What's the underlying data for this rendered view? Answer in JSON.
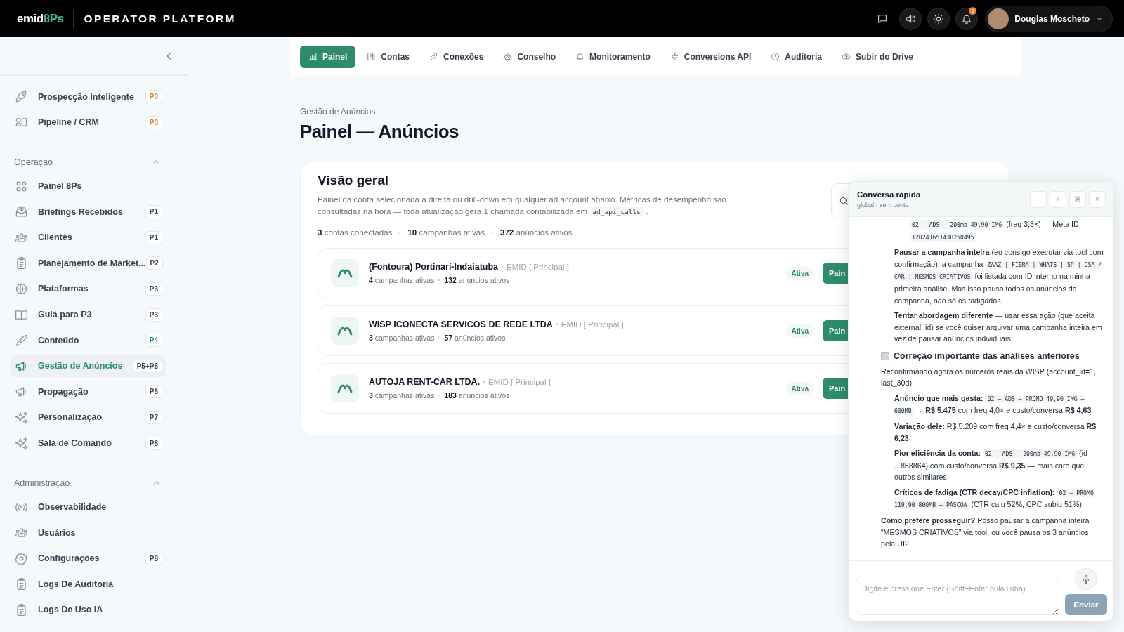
{
  "topbar": {
    "logo": {
      "text": "emid",
      "accent": "8Ps"
    },
    "title": "OPERATOR PLATFORM",
    "notification_count": "2",
    "user": {
      "name": "Douglas Moscheto"
    }
  },
  "sidebar": {
    "sections": [
      {
        "items": [
          {
            "label": "Prospecção Inteligente",
            "badge": "P0",
            "color": "#d9822b",
            "selected": false
          },
          {
            "label": "Pipeline / CRM",
            "badge": "P0",
            "color": "#d9822b",
            "selected": false
          }
        ]
      },
      {
        "title": "Operação",
        "expanded": true,
        "items": [
          {
            "label": "Painel 8Ps",
            "selected": false
          },
          {
            "label": "Briefings Recebidos",
            "badge": "P1",
            "color": "#374151",
            "selected": false
          },
          {
            "label": "Clientes",
            "badge": "P1",
            "color": "#374151",
            "selected": false
          },
          {
            "label": "Planejamento de Market...",
            "badge": "P2",
            "color": "#374151",
            "selected": false
          },
          {
            "label": "Plataformas",
            "badge": "P3",
            "color": "#374151",
            "selected": false
          },
          {
            "label": "Guia para P3",
            "badge": "P3",
            "color": "#374151",
            "selected": false
          },
          {
            "label": "Conteúdo",
            "badge": "P4",
            "color": "#2e8b6e",
            "selected": false
          },
          {
            "label": "Gestão de Anúncios",
            "badge": "P5+P8",
            "color": "#374151",
            "selected": true
          },
          {
            "label": "Propagação",
            "badge": "P6",
            "color": "#374151",
            "selected": false
          },
          {
            "label": "Personalização",
            "badge": "P7",
            "color": "#374151",
            "selected": false
          },
          {
            "label": "Sala de Comando",
            "badge": "P8",
            "color": "#374151",
            "selected": false
          }
        ]
      },
      {
        "title": "Administração",
        "expanded": true,
        "items": [
          {
            "label": "Observabilidade",
            "selected": false
          },
          {
            "label": "Usuários",
            "selected": false
          },
          {
            "label": "Configurações",
            "badge": "P8",
            "color": "#374151",
            "selected": false
          },
          {
            "label": "Logs De Auditoria",
            "selected": false
          },
          {
            "label": "Logs De Uso IA",
            "selected": false
          }
        ]
      }
    ]
  },
  "tabs": [
    {
      "label": "Painel",
      "selected": true
    },
    {
      "label": "Contas",
      "selected": false
    },
    {
      "label": "Conexões",
      "selected": false
    },
    {
      "label": "Conselho",
      "selected": false
    },
    {
      "label": "Monitoramento",
      "selected": false
    },
    {
      "label": "Conversions API",
      "selected": false
    },
    {
      "label": "Auditoria",
      "selected": false
    },
    {
      "label": "Subir do Drive",
      "selected": false
    }
  ],
  "page": {
    "breadcrumb": "Gestão de Anúncios",
    "title": "Painel — Anúncios"
  },
  "overview": {
    "title": "Visão geral",
    "description": [
      {
        "kind": "text",
        "text": "Painel da conta selecionada à direita ou drill-down em qualquer ad account abaixo. Métricas de desempenho são consultadas na hora — toda atualização gera 1 chamada contabilizada em "
      },
      {
        "kind": "code",
        "text": "ad_api_calls"
      },
      {
        "kind": "text",
        "text": " ."
      }
    ],
    "stats": [
      "**3** contas conectadas",
      "**10** campanhas ativas",
      "**372** anúncios ativos"
    ],
    "accounts": [
      {
        "name": "(Fontoura) Portinari-Indaiatuba",
        "tag": "EMID [ Principal ]",
        "campaigns": "4",
        "campaigns_label": "campanhas ativas",
        "ads": "132",
        "ads_label": "anúncios ativos",
        "status": "Ativa",
        "button": "Pain"
      },
      {
        "name": "WISP ICONECTA SERVICOS DE REDE LTDA",
        "tag": "EMID [ Principal ]",
        "campaigns": "3",
        "campaigns_label": "campanhas ativas",
        "ads": "57",
        "ads_label": "anúncios ativos",
        "status": "Ativa",
        "button": "Pain"
      },
      {
        "name": "AUTOJA RENT-CAR LTDA.",
        "tag": "EMID [ Principal ]",
        "campaigns": "3",
        "campaigns_label": "campanhas ativas",
        "ads": "183",
        "ads_label": "anúncios ativos",
        "status": "Ativa",
        "button": "Pain"
      }
    ]
  },
  "chat": {
    "title": "Conversa rápida",
    "subtitle": "global · sem conta",
    "header_buttons": [
      "·",
      "+",
      "⌘",
      "×"
    ],
    "blocks": [
      {
        "kind": "subitem",
        "segments": [
          {
            "kind": "code",
            "text": "02 – ADS – 200mb 49,90 IMG"
          },
          {
            "kind": "text",
            "text": " (freq 3,3×) — Meta ID "
          },
          {
            "kind": "code",
            "text": "120241651438250495"
          }
        ]
      },
      {
        "kind": "item",
        "segments": [
          {
            "kind": "text",
            "text": "**Pausar a campanha inteira** (eu consigo executar via tool com confirmação): a campanha "
          },
          {
            "kind": "code",
            "text": "ZAAZ | FIBRA | WHATS | SP | OSA / CAR | MESMOS CRIATIVOS"
          },
          {
            "kind": "text",
            "text": " foi listada com ID interno na minha primeira análise. Mas isso pausa todos os anúncios da campanha, não só os fadigados."
          }
        ]
      },
      {
        "kind": "item",
        "segments": [
          {
            "kind": "text",
            "text": "**Tentar abordagem diferente** — usar essa ação (que aceita external_id) se você quiser arquivar uma campanha inteira em vez de pausar anúncios individuais."
          }
        ]
      },
      {
        "kind": "heading",
        "segments": [
          {
            "kind": "text",
            "text": "Correção importante das análises anteriores"
          }
        ]
      },
      {
        "kind": "para",
        "segments": [
          {
            "kind": "text",
            "text": "Reconfirmando agora os números reais da WISP (account_id=1, last_30d):"
          }
        ]
      },
      {
        "kind": "item",
        "segments": [
          {
            "kind": "text",
            "text": "**Anúncio que mais gasta:** "
          },
          {
            "kind": "code",
            "text": "02 – ADS – PROMO 49,90 IMG – 600MB"
          },
          {
            "kind": "text",
            "text": " → **R$ 5.475** com freq 4,0× e custo/conversa **R$ 4,63**"
          }
        ]
      },
      {
        "kind": "item",
        "segments": [
          {
            "kind": "text",
            "text": "**Variação dele:** R$ 5.209 com freq 4,4× e custo/conversa **R$ 6,23**"
          }
        ]
      },
      {
        "kind": "item",
        "segments": [
          {
            "kind": "text",
            "text": "**Pior eficiência da conta:** "
          },
          {
            "kind": "code",
            "text": "02 – ADS – 200mb 49,90 IMG"
          },
          {
            "kind": "text",
            "text": " (id ...858864) com custo/conversa **R$ 9,35** — mais caro que outros similares"
          }
        ]
      },
      {
        "kind": "item",
        "segments": [
          {
            "kind": "text",
            "text": "**Críticos de fadiga (CTR decay/CPC inflation):** "
          },
          {
            "kind": "code",
            "text": "02 – PROMO 119,90 800MB – PÁSCOA"
          },
          {
            "kind": "text",
            "text": " (CTR caiu 52%, CPC subiu 51%)"
          }
        ]
      },
      {
        "kind": "para",
        "segments": [
          {
            "kind": "text",
            "text": "**Como prefere prosseguir?** Posso pausar a campanha inteira “MESMOS CRIATIVOS” via tool, ou você pausa os 3 anúncios pela UI?"
          }
        ]
      }
    ],
    "input": {
      "placeholder": "Digite e pressione Enter (Shift+Enter pula linha)"
    },
    "send": {
      "label": "Enviar",
      "disabled": true
    }
  }
}
